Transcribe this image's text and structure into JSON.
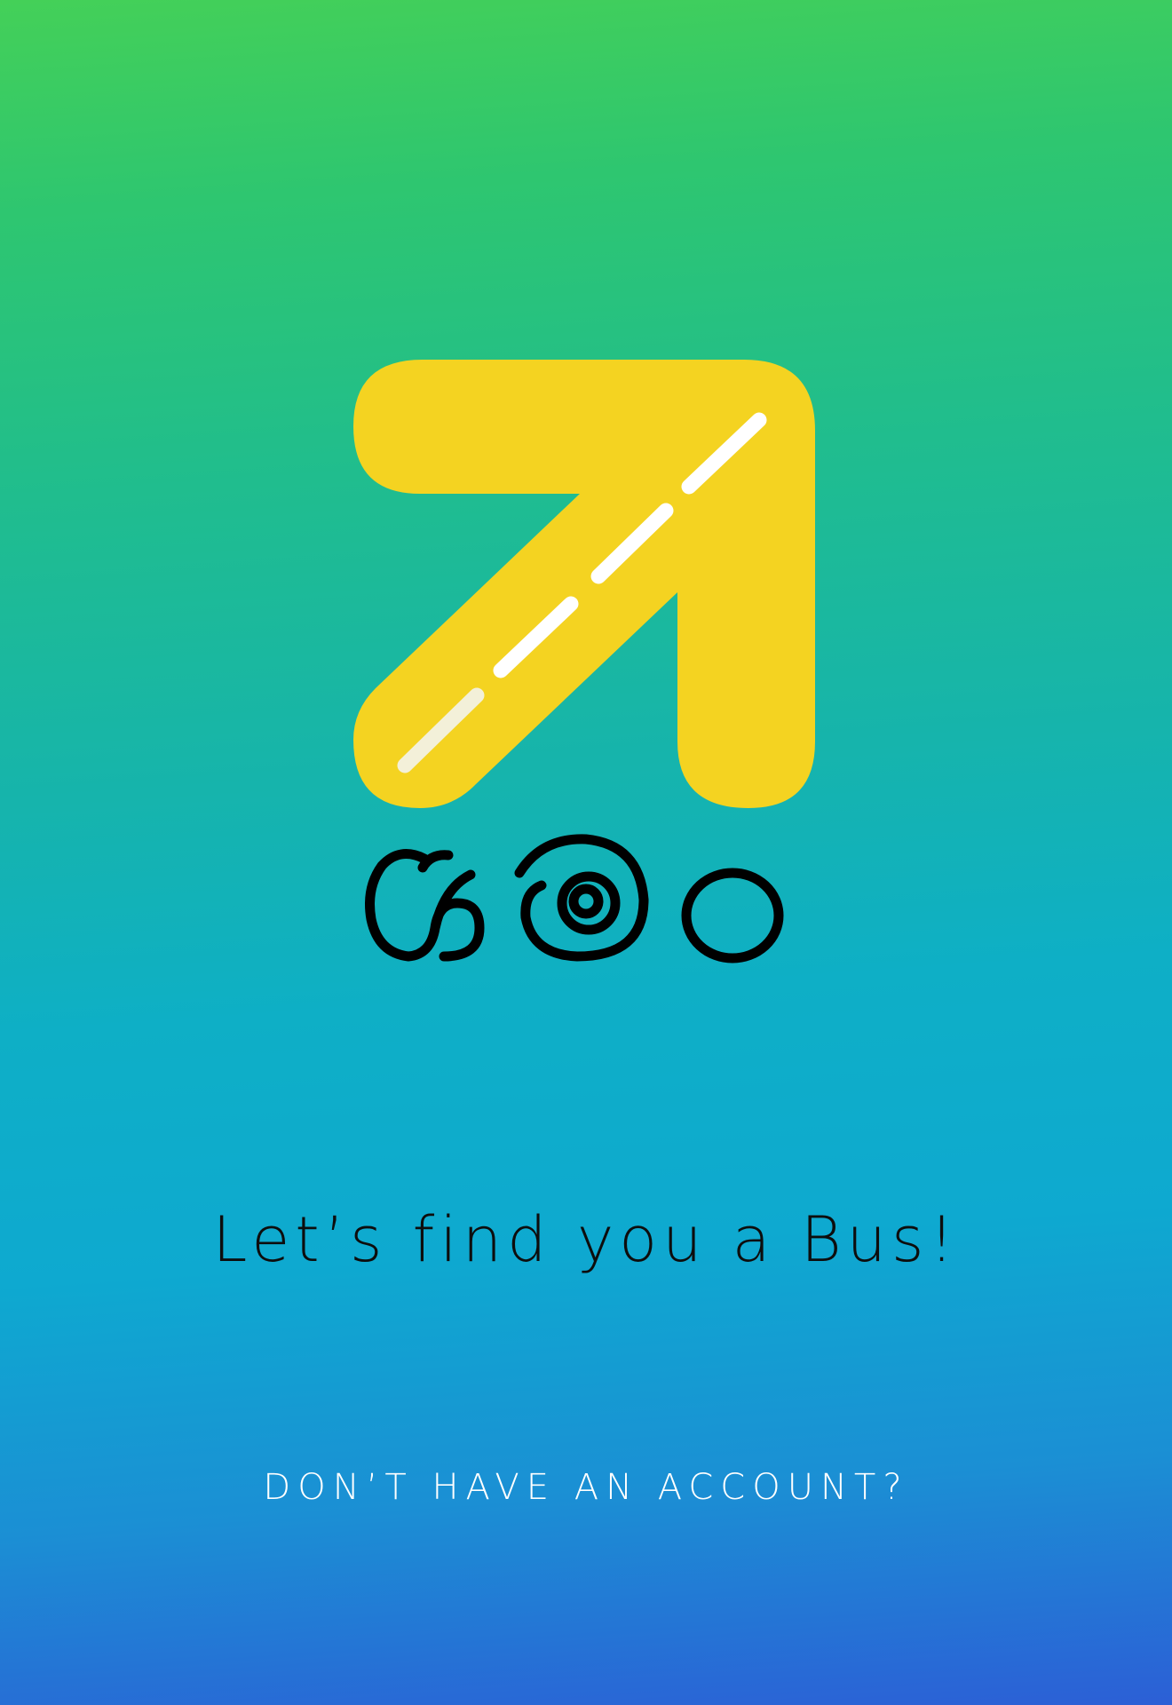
{
  "brand": {
    "logo_icon": "arrow-up-right-road-icon",
    "wordmark": "යමං",
    "logo_color": "#F4D321",
    "road_dash_color": "#FFFFFF",
    "wordmark_color": "#000000"
  },
  "welcome": {
    "tagline": "Let’s find you a Bus!"
  },
  "account": {
    "signup_prompt": "DON’T HAVE AN ACCOUNT?"
  },
  "theme": {
    "gradient_top": "#44D058",
    "gradient_middle": "#0EAFC6",
    "gradient_bottom": "#2C5FD6"
  }
}
